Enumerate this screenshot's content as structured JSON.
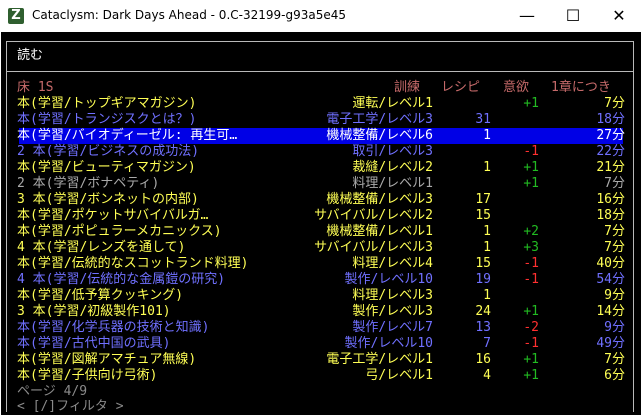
{
  "window": {
    "title": "Cataclysm: Dark Days Ahead - 0.C-32199-g93a5e45",
    "icon_glyph": "Z",
    "minimize": "—",
    "maximize": "☐",
    "close": "✕"
  },
  "menu": {
    "title": "読む",
    "columns": {
      "category": "床 1S",
      "training": "訓練",
      "recipes": "レシピ",
      "motivation": "意欲",
      "time_per_chapter": "1章につき"
    },
    "rows": [
      {
        "name": "本(学習/トップギアマガジン)",
        "skill": "運転/レベル1",
        "recipes": "",
        "motivation": "+1",
        "time": "7分",
        "style": "rk"
      },
      {
        "name": "本(学習/トランジスクとは？)",
        "skill": "電子工学/レベル3",
        "recipes": "31",
        "motivation": "",
        "time": "18分",
        "style": "rb"
      },
      {
        "name": "本(学習/バイオディーゼル: 再生可…",
        "skill": "機械整備/レベル6",
        "recipes": "1",
        "motivation": "",
        "time": "27分",
        "style": "rw",
        "selected": true
      },
      {
        "name": "2 本(学習/ビジネスの成功法)",
        "skill": "取引/レベル3",
        "recipes": "",
        "motivation": "-1",
        "time": "22分",
        "style": "rb"
      },
      {
        "name": "本(学習/ビューティマガジン)",
        "skill": "裁縫/レベル2",
        "recipes": "1",
        "motivation": "+1",
        "time": "21分",
        "style": "rk"
      },
      {
        "name": "2 本(学習/ボナペティ)",
        "skill": "料理/レベル1",
        "recipes": "",
        "motivation": "+1",
        "time": "7分",
        "style": "rg"
      },
      {
        "name": "3 本(学習/ボンネットの内部)",
        "skill": "機械整備/レベル3",
        "recipes": "17",
        "motivation": "",
        "time": "16分",
        "style": "rk"
      },
      {
        "name": "本(学習/ポケットサバイバルガ…",
        "skill": "サバイバル/レベル2",
        "recipes": "15",
        "motivation": "",
        "time": "18分",
        "style": "rk"
      },
      {
        "name": "本(学習/ポピュラーメカニックス)",
        "skill": "機械整備/レベル1",
        "recipes": "1",
        "motivation": "+2",
        "time": "7分",
        "style": "rk"
      },
      {
        "name": "4 本(学習/レンズを通して)",
        "skill": "サバイバル/レベル3",
        "recipes": "1",
        "motivation": "+3",
        "time": "7分",
        "style": "rk"
      },
      {
        "name": "本(学習/伝統的なスコットランド料理)",
        "skill": "料理/レベル4",
        "recipes": "15",
        "motivation": "-1",
        "time": "40分",
        "style": "rk"
      },
      {
        "name": "4 本(学習/伝統的な金属鎧の研究)",
        "skill": "製作/レベル10",
        "recipes": "19",
        "motivation": "-1",
        "time": "54分",
        "style": "rb"
      },
      {
        "name": "本(学習/低予算クッキング)",
        "skill": "料理/レベル3",
        "recipes": "1",
        "motivation": "",
        "time": "9分",
        "style": "rk"
      },
      {
        "name": "3 本(学習/初級製作101)",
        "skill": "製作/レベル3",
        "recipes": "24",
        "motivation": "+1",
        "time": "14分",
        "style": "rk"
      },
      {
        "name": "本(学習/化学兵器の技術と知識)",
        "skill": "製作/レベル7",
        "recipes": "13",
        "motivation": "-2",
        "time": "9分",
        "style": "rb"
      },
      {
        "name": "本(学習/古代中国の武具)",
        "skill": "製作/レベル10",
        "recipes": "7",
        "motivation": "-1",
        "time": "49分",
        "style": "rb"
      },
      {
        "name": "本(学習/図解アマチュア無線)",
        "skill": "電子工学/レベル1",
        "recipes": "16",
        "motivation": "+1",
        "time": "7分",
        "style": "rk"
      },
      {
        "name": "本(学習/子供向け弓術)",
        "skill": "弓/レベル1",
        "recipes": "4",
        "motivation": "+1",
        "time": "6分",
        "style": "rk"
      }
    ],
    "page": "ページ 4/9",
    "filter_hint": "< [/]フィルタ >"
  }
}
